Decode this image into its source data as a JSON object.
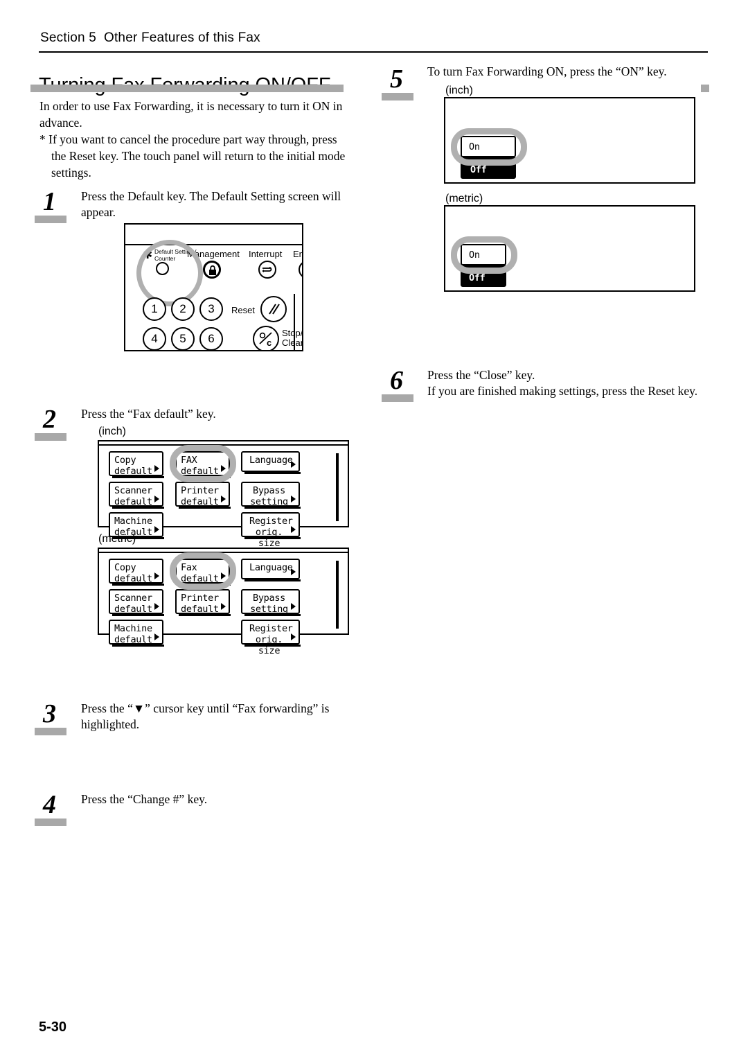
{
  "header": {
    "section_label": "Section 5  Other Features of this Fax"
  },
  "title": "Turning Fax Forwarding ON/OFF",
  "intro": {
    "paragraph": "In order to use Fax Forwarding, it is necessary to turn it ON in advance.",
    "note": "*  If you want to cancel the procedure part way through, press the Reset key. The touch panel will return to the initial mode settings."
  },
  "steps": [
    {
      "number": "1",
      "text": "Press the Default key. The Default Setting screen will appear."
    },
    {
      "number": "2",
      "text": "Press the “Fax default” key."
    },
    {
      "number": "3",
      "text": "Press the “▼” cursor key until “Fax forwarding” is highlighted."
    },
    {
      "number": "4",
      "text": "Press the “Change #” key."
    },
    {
      "number": "5",
      "text": "To turn Fax Forwarding ON, press the “ON” key."
    },
    {
      "number": "6",
      "text": "Press the “Close” key.\nIf you are finished making settings, press the Reset key."
    }
  ],
  "control_panel": {
    "keys": [
      {
        "label": "Default Setting /\nCounter",
        "icon": "asterisk-icon"
      },
      {
        "label": "Management",
        "icon": "lock-icon"
      },
      {
        "label": "Interrupt",
        "icon": "interrupt-icon"
      },
      {
        "label": "Energ",
        "icon": "energy-saver-icon"
      }
    ],
    "numeric_keys": [
      "1",
      "2",
      "3",
      "4",
      "5",
      "6"
    ],
    "reset_label": "Reset",
    "stop_clear_label": "Stop/\nClear",
    "stop_clear_glyph": "%⁄c"
  },
  "captions": {
    "inch": "(inch)",
    "metric": "(metric)"
  },
  "default_setting_screen": {
    "inch_keys": [
      "Copy\ndefault",
      "FAX\ndefault",
      "Language",
      "Scanner\ndefault",
      "Printer\ndefault",
      "Bypass\nsetting",
      "Machine\ndefault",
      "Register\norig. size"
    ],
    "metric_keys": [
      "Copy\ndefault",
      "Fax\ndefault",
      "Language",
      "Scanner\ndefault",
      "Printer\ndefault",
      "Bypass\nsetting",
      "Machine\ndefault",
      "Register\norig. size"
    ],
    "highlighted_inch": "FAX\ndefault",
    "highlighted_metric": "Fax\ndefault"
  },
  "onoff_screen": {
    "on_label": "On",
    "off_label": "Off",
    "selected": "Off",
    "highlighted": "On"
  },
  "footer": {
    "page_number": "5-30"
  },
  "colors": {
    "accent_gray": "#a8a8a8",
    "ring_gray": "#b0b0b0",
    "ink": "#000000",
    "paper": "#ffffff"
  }
}
